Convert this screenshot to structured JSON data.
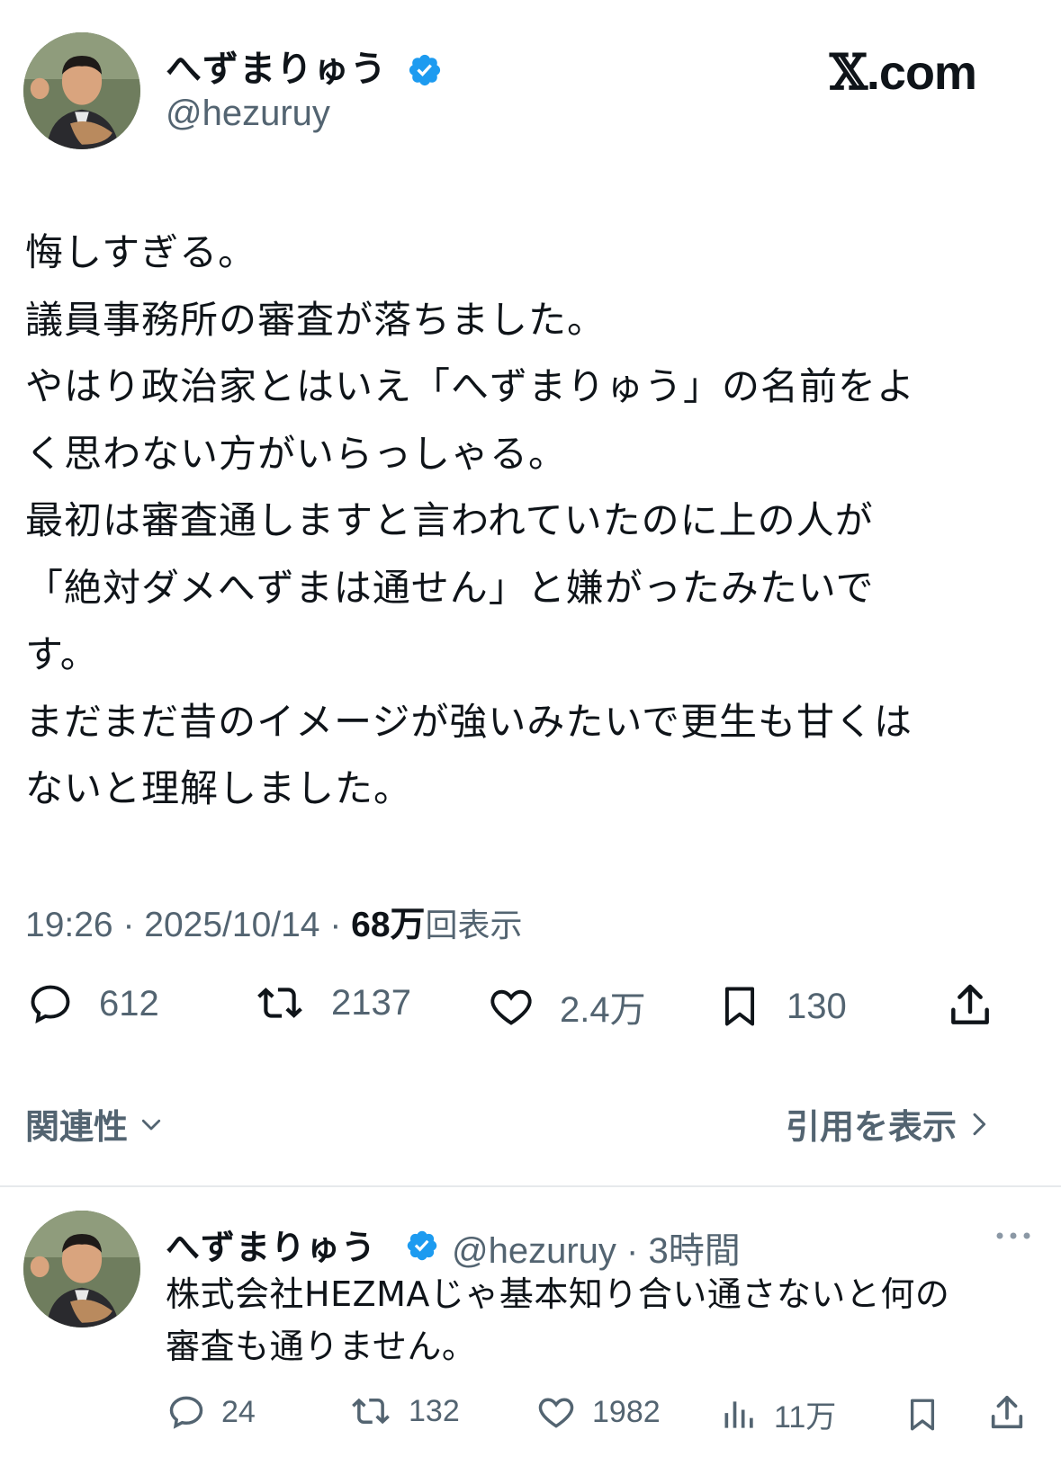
{
  "brand": {
    "site": "X.com"
  },
  "tweet": {
    "author": {
      "name": "へずまりゅう",
      "handle": "@hezuruy",
      "verified": true
    },
    "body": "悔しすぎる。\n議員事務所の審査が落ちました。\nやはり政治家とはいえ「へずまりゅう」の名前をよ\nく思わない方がいらっしゃる。\n最初は審査通しますと言われていたのに上の人が\n「絶対ダメへずまは通せん」と嫌がったみたいで\nす。\nまだまだ昔のイメージが強いみたいで更生も甘くは\nないと理解しました。",
    "time": "19:26",
    "date": "2025/10/14",
    "views_count": "68万",
    "views_label": "回表示",
    "stats": {
      "replies": "612",
      "reposts": "2137",
      "likes": "2.4万",
      "bookmarks": "130"
    },
    "related_label": "関連性",
    "quotes_label": "引用を表示"
  },
  "reply": {
    "author": {
      "name": "へずまりゅう",
      "handle": "@hezuruy",
      "verified": true
    },
    "time_ago": "3時間",
    "text": "株式会社HEZMAじゃ基本知り合い通さないと何の\n審査も通りません。",
    "stats": {
      "replies": "24",
      "reposts": "132",
      "likes": "1982",
      "views": "11万"
    }
  },
  "colors": {
    "verified": "#1d9bf0",
    "text": "#0f1419",
    "muted": "#536471",
    "divider": "#e6e9ec"
  },
  "icons": [
    "avatar",
    "verified-badge-icon",
    "reply-icon",
    "repost-icon",
    "like-icon",
    "bookmark-icon",
    "share-icon",
    "chevron-down-icon",
    "chevron-right-icon",
    "more-icon",
    "views-icon"
  ]
}
